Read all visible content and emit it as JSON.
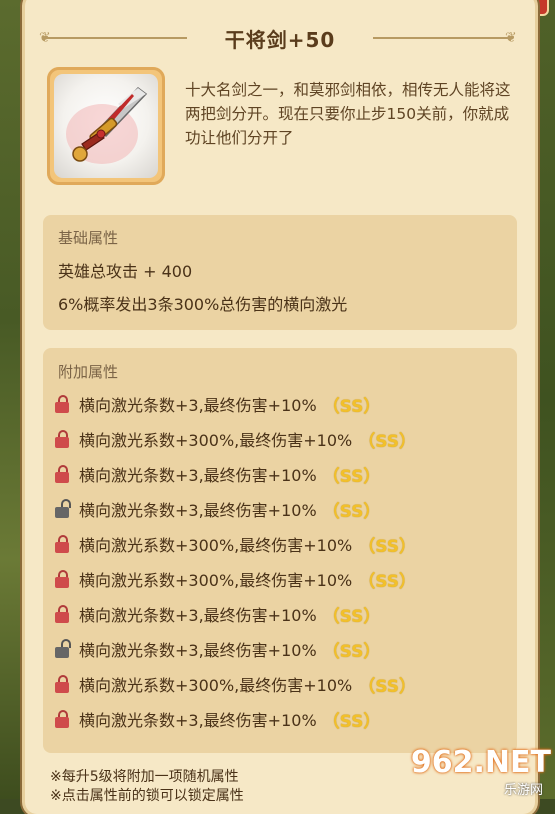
{
  "dialog": {
    "title": "干将剑+50",
    "description": "十大名剑之一，和莫邪剑相依，相传无人能将这两把剑分开。现在只要你止步150关前，你就成功让他们分开了"
  },
  "base_attributes": {
    "label": "基础属性",
    "lines": [
      "英雄总攻击 + 400",
      "6%概率发出3条300%总伤害的横向激光"
    ]
  },
  "extra_attributes": {
    "label": "附加属性",
    "rows": [
      {
        "text": "横向激光条数+3,最终伤害+10%",
        "grade": "（SS）",
        "locked": true
      },
      {
        "text": "横向激光系数+300%,最终伤害+10%",
        "grade": "（SS）",
        "locked": true
      },
      {
        "text": "横向激光条数+3,最终伤害+10%",
        "grade": "（SS）",
        "locked": true
      },
      {
        "text": "横向激光条数+3,最终伤害+10%",
        "grade": "（SS）",
        "locked": false
      },
      {
        "text": "横向激光系数+300%,最终伤害+10%",
        "grade": "（SS）",
        "locked": true
      },
      {
        "text": "横向激光系数+300%,最终伤害+10%",
        "grade": "（SS）",
        "locked": true
      },
      {
        "text": "横向激光条数+3,最终伤害+10%",
        "grade": "（SS）",
        "locked": true
      },
      {
        "text": "横向激光条数+3,最终伤害+10%",
        "grade": "（SS）",
        "locked": false
      },
      {
        "text": "横向激光系数+300%,最终伤害+10%",
        "grade": "（SS）",
        "locked": true
      },
      {
        "text": "横向激光条数+3,最终伤害+10%",
        "grade": "（SS）",
        "locked": true
      }
    ]
  },
  "footer_notes": [
    "※每升5级将附加一项随机属性",
    "※点击属性前的锁可以锁定属性"
  ],
  "watermark": {
    "main": "962.NET",
    "sub": "乐游网"
  },
  "colors": {
    "card_bg": "#f6e8c6",
    "panel_bg": "#ebd3a3",
    "grade_gold": "#f2c02a",
    "lock_red": "#cf4b4b",
    "lock_open_gray": "#666666"
  },
  "icons": {
    "locked": "red-padlock-icon",
    "unlocked": "gray-open-padlock-icon",
    "item": "sword-icon"
  }
}
